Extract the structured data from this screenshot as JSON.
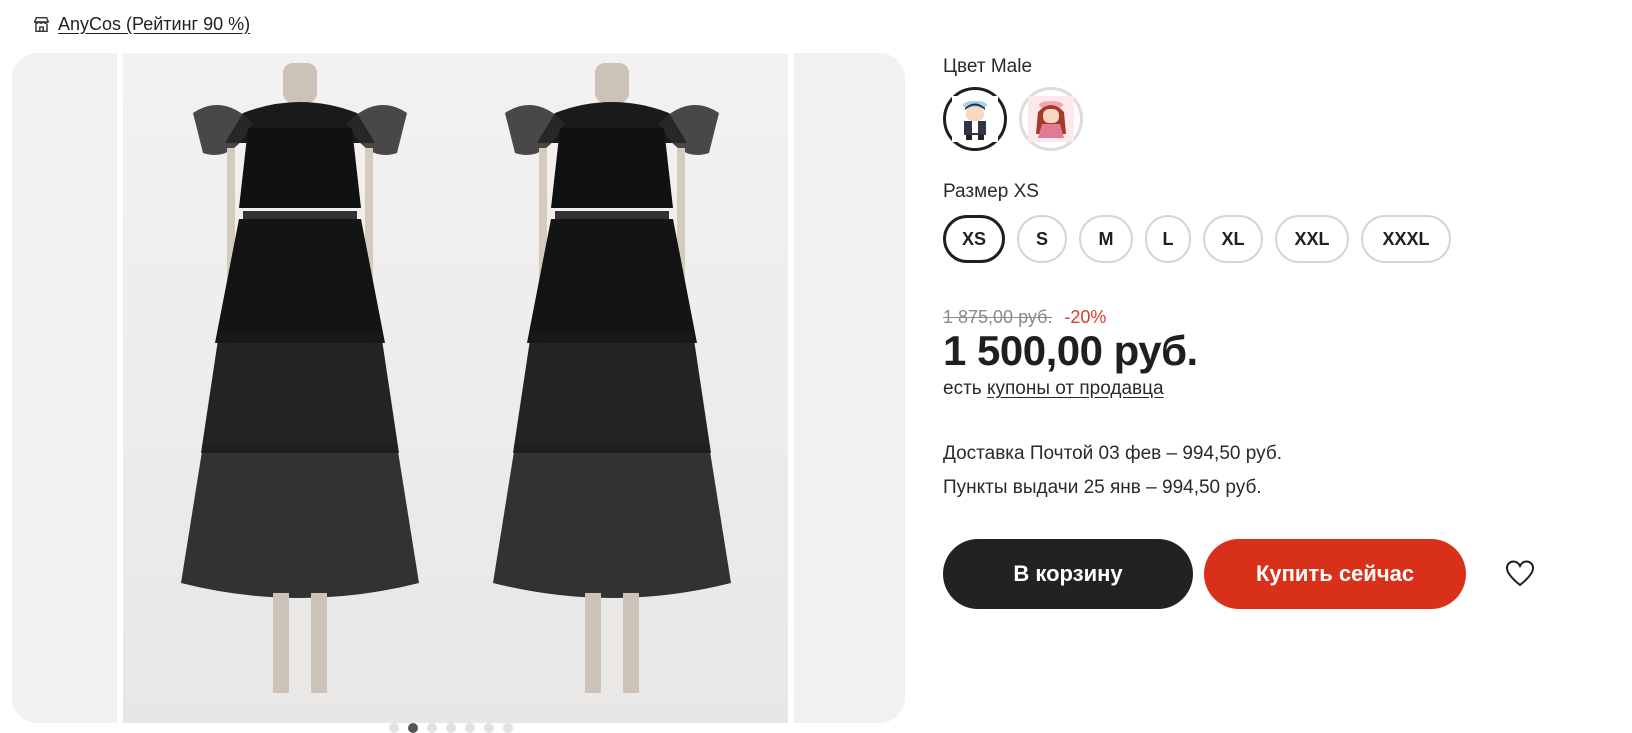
{
  "store": {
    "name": "AnyCos (Рейтинг 90 %)",
    "icon": "store-icon"
  },
  "gallery": {
    "slide_count": 7,
    "active_index": 1
  },
  "color": {
    "label": "Цвет Male",
    "options": [
      {
        "name": "Male",
        "icon": "boy-avatar-icon",
        "selected": true
      },
      {
        "name": "Female",
        "icon": "girl-avatar-icon",
        "selected": false
      }
    ]
  },
  "size": {
    "label": "Размер XS",
    "options": [
      "XS",
      "S",
      "M",
      "L",
      "XL",
      "XXL",
      "XXXL"
    ],
    "selected": "XS"
  },
  "pricing": {
    "old_price": "1 875,00 руб.",
    "discount": "-20%",
    "price": "1 500,00 руб.",
    "coupons_prefix": "есть",
    "coupons_link": "купоны от продавца"
  },
  "delivery": {
    "post": "Доставка Почтой 03 фев – 994,50 руб.",
    "pickup": "Пункты выдачи 25 янв – 994,50 руб."
  },
  "actions": {
    "cart_label": "В корзину",
    "buy_label": "Купить сейчас",
    "favorite_icon": "heart-icon"
  },
  "colors": {
    "buy": "#d9301a",
    "cart": "#222222",
    "discount": "#e03a2b"
  }
}
